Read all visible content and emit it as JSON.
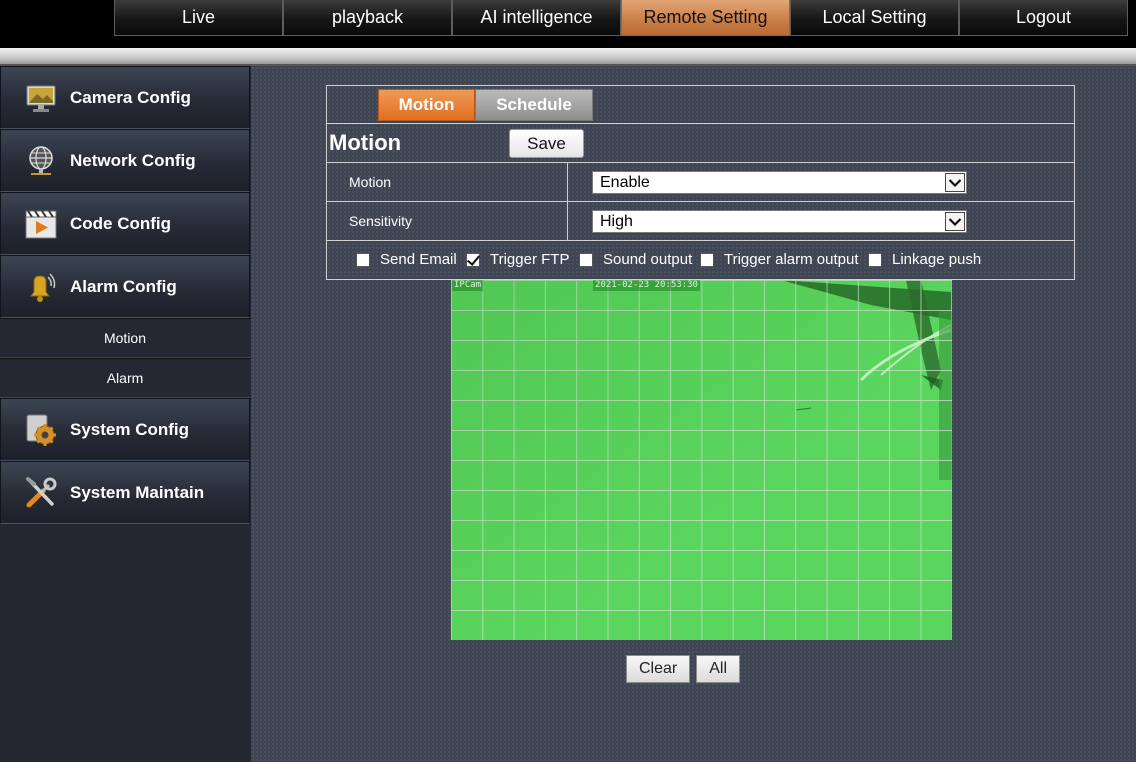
{
  "top_nav": {
    "items": [
      {
        "label": "Live"
      },
      {
        "label": "playback"
      },
      {
        "label": "AI intelligence"
      },
      {
        "label": "Remote Setting",
        "active": true
      },
      {
        "label": "Local Setting"
      },
      {
        "label": "Logout"
      }
    ]
  },
  "sidebar": {
    "camera_config": "Camera Config",
    "network_config": "Network Config",
    "code_config": "Code Config",
    "alarm_config": "Alarm Config",
    "alarm_sub": [
      "Motion",
      "Alarm"
    ],
    "system_config": "System Config",
    "system_maintain": "System Maintain"
  },
  "tabs": {
    "motion": "Motion",
    "schedule": "Schedule"
  },
  "section": {
    "title": "Motion",
    "save_label": "Save"
  },
  "fields": {
    "motion_label": "Motion",
    "motion_value": "Enable",
    "sensitivity_label": "Sensitivity",
    "sensitivity_value": "High"
  },
  "checks": [
    {
      "label": "Send Email",
      "checked": false
    },
    {
      "label": "Trigger FTP",
      "checked": true
    },
    {
      "label": "Sound output",
      "checked": false
    },
    {
      "label": "Trigger alarm output",
      "checked": false
    },
    {
      "label": "Linkage push",
      "checked": false
    }
  ],
  "video": {
    "osd_name": "IPCam",
    "osd_time": "2021-02-23 20:53:30"
  },
  "buttons": {
    "clear": "Clear",
    "all": "All"
  },
  "colors": {
    "active_nav": "#c97d45",
    "active_tab": "#e06f22",
    "motion_overlay": "#5ad55d"
  }
}
